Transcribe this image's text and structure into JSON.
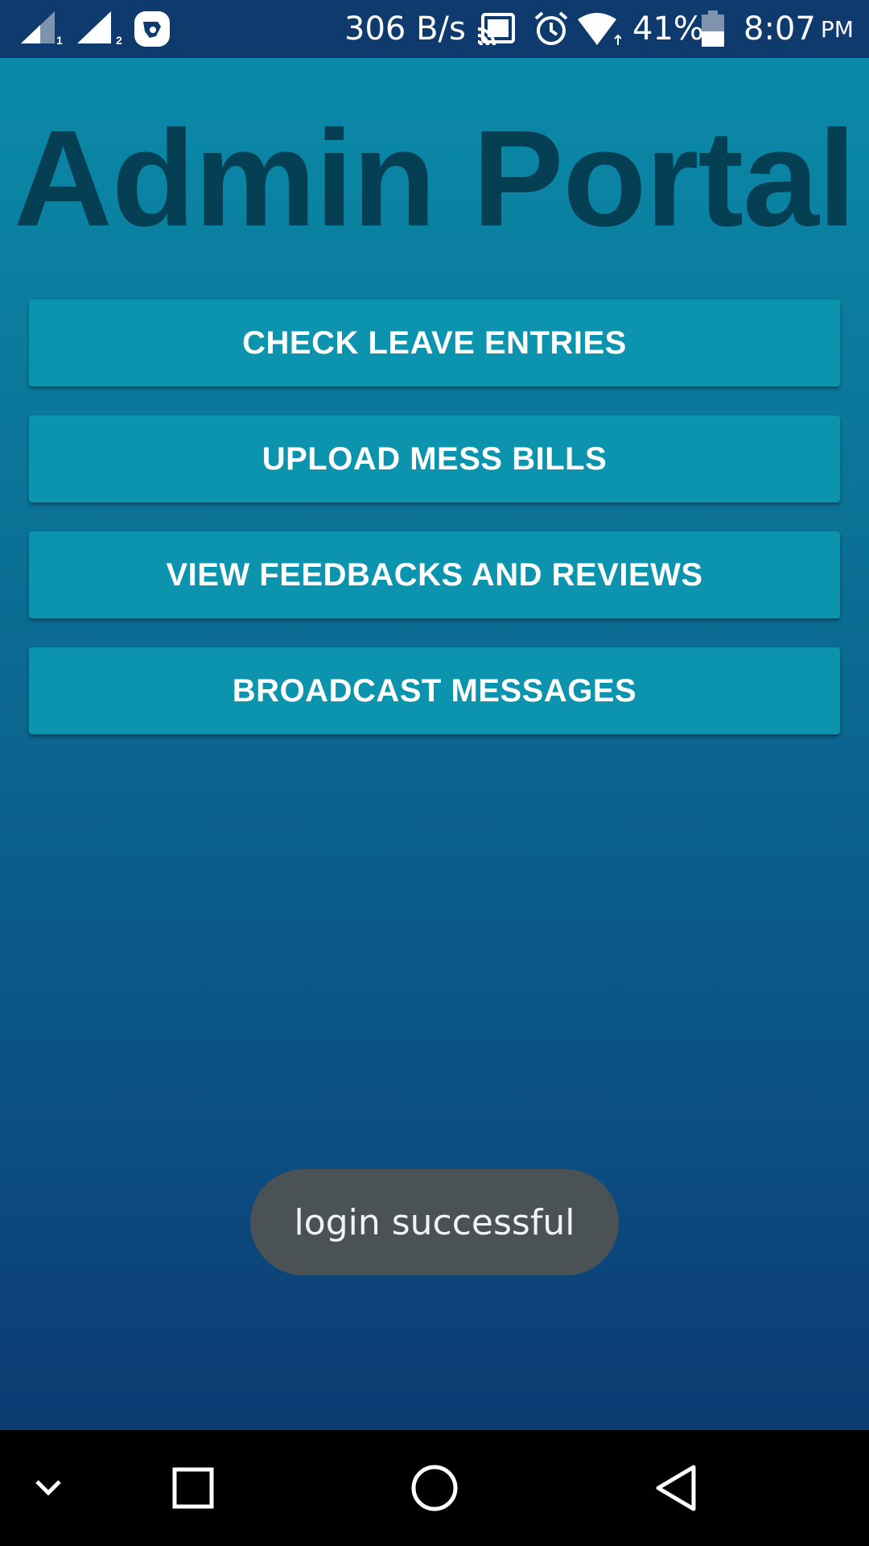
{
  "status_bar": {
    "network_speed": "306 B/s",
    "battery_percent": "41%",
    "time": "8:07",
    "ampm": "PM",
    "sim1_label": "1",
    "sim2_label": "2",
    "icons": [
      "signal-sim1-icon",
      "signal-sim2-icon",
      "app-notification-icon",
      "cast-icon",
      "alarm-icon",
      "wifi-icon",
      "battery-icon"
    ]
  },
  "page": {
    "title": "Admin Portal"
  },
  "menu": {
    "buttons": [
      {
        "label": "CHECK LEAVE ENTRIES"
      },
      {
        "label": "UPLOAD MESS BILLS"
      },
      {
        "label": "VIEW FEEDBACKS AND REVIEWS"
      },
      {
        "label": "BROADCAST MESSAGES"
      }
    ]
  },
  "toast": {
    "message": "login successful"
  },
  "nav_bar": {
    "icons": [
      "collapse-icon",
      "recent-apps-icon",
      "home-icon",
      "back-icon"
    ]
  },
  "colors": {
    "status_bar": "#0e3a6e",
    "title": "#053f54",
    "button": "#0c93ad",
    "toast": "#4b5256"
  }
}
